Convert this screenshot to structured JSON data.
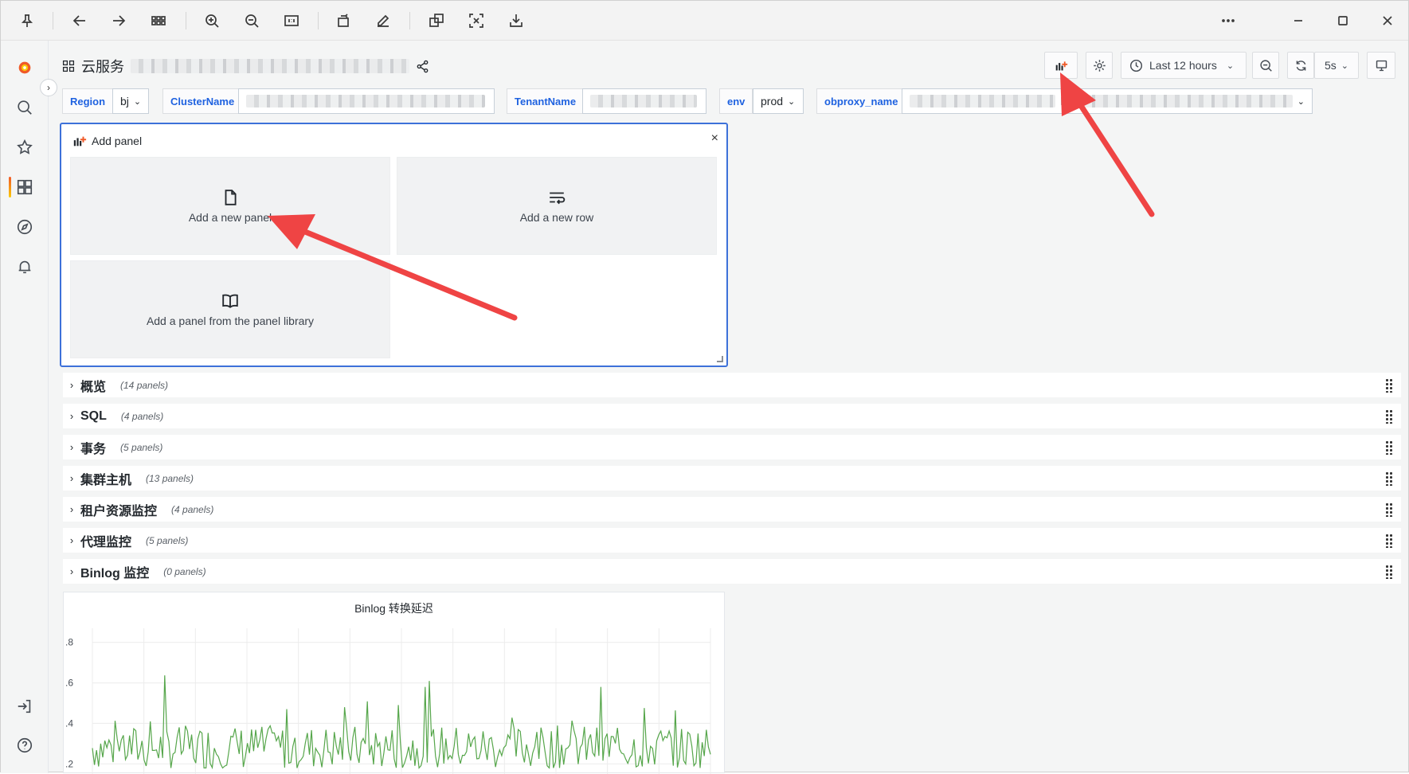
{
  "viewer_toolbar": {
    "icons": [
      "pin-icon",
      "back-icon",
      "forward-icon",
      "grid-icon",
      "zoom-in-icon",
      "zoom-out-icon",
      "actual-size-icon",
      "rotate-icon",
      "edit-icon",
      "translate-icon",
      "ocr-icon",
      "download-icon"
    ],
    "window_controls": [
      "more-icon",
      "minimize-icon",
      "maximize-icon",
      "close-icon"
    ]
  },
  "sidenav": {
    "items": [
      "grafana-logo-icon",
      "search-icon",
      "star-icon",
      "dashboards-icon",
      "explore-icon",
      "alerting-icon"
    ],
    "bottom": [
      "sign-in-icon",
      "help-icon"
    ],
    "active": "dashboards-icon"
  },
  "dashboard": {
    "title_prefix": "云服务",
    "time_range": "Last 12 hours",
    "refresh": "5s"
  },
  "variables": [
    {
      "label": "Region",
      "value": "bj"
    },
    {
      "label": "ClusterName",
      "value": ""
    },
    {
      "label": "TenantName",
      "value": ""
    },
    {
      "label": "env",
      "value": "prod"
    },
    {
      "label": "obproxy_name",
      "value": "h"
    }
  ],
  "add_panel": {
    "title": "Add panel",
    "close": "×",
    "options": {
      "new_panel": "Add a new panel",
      "new_row": "Add a new row",
      "library": "Add a panel from the panel library"
    }
  },
  "rows": [
    {
      "title": "概览",
      "count": "(14 panels)"
    },
    {
      "title": "SQL",
      "count": "(4 panels)"
    },
    {
      "title": "事务",
      "count": "(5 panels)"
    },
    {
      "title": "集群主机",
      "count": "(13 panels)"
    },
    {
      "title": "租户资源监控",
      "count": "(4 panels)"
    },
    {
      "title": "代理监控",
      "count": "(5 panels)"
    },
    {
      "title": "Binlog 监控",
      "count": "(0 panels)"
    }
  ],
  "chart_data": {
    "type": "line",
    "title": "Binlog 转换延迟",
    "xlabel": "",
    "ylabel": "",
    "ylim": [
      0.15,
      0.85
    ],
    "yticks": [
      ".8",
      ".6",
      ".4",
      ".2"
    ],
    "ytick_values": [
      0.8,
      0.6,
      0.4,
      0.2
    ],
    "series": [
      {
        "color": "#56a64b",
        "y_range": [
          0.18,
          0.78
        ],
        "points": 300
      }
    ],
    "grid": true
  },
  "colors": {
    "accent": "#3d71d9",
    "label": "#1f62e0",
    "series": "#56a64b",
    "annotation_arrow": "#ef4444"
  }
}
